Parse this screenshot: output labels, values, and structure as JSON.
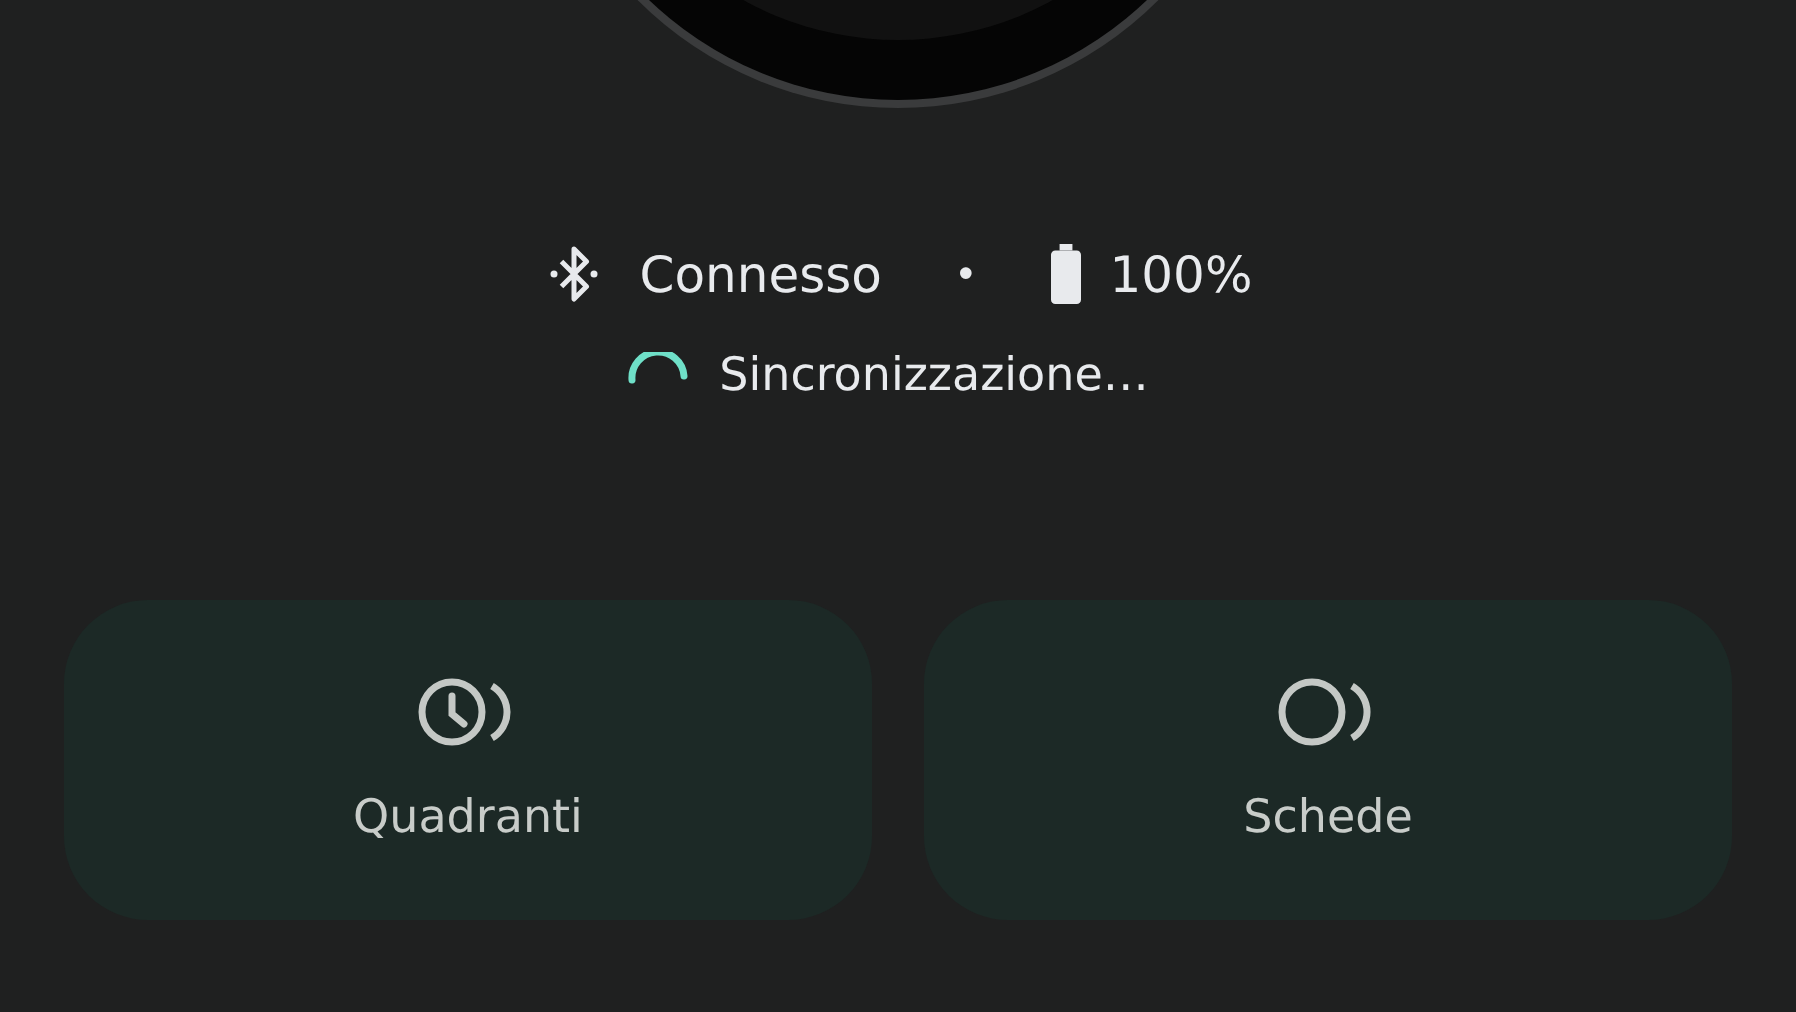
{
  "status": {
    "connection": "Connesso",
    "separator": "•",
    "battery": "100%"
  },
  "sync": {
    "label": "Sincronizzazione…"
  },
  "cards": [
    {
      "kind": "watch_faces",
      "label": "Quadranti"
    },
    {
      "kind": "tiles",
      "label": "Schede"
    }
  ]
}
